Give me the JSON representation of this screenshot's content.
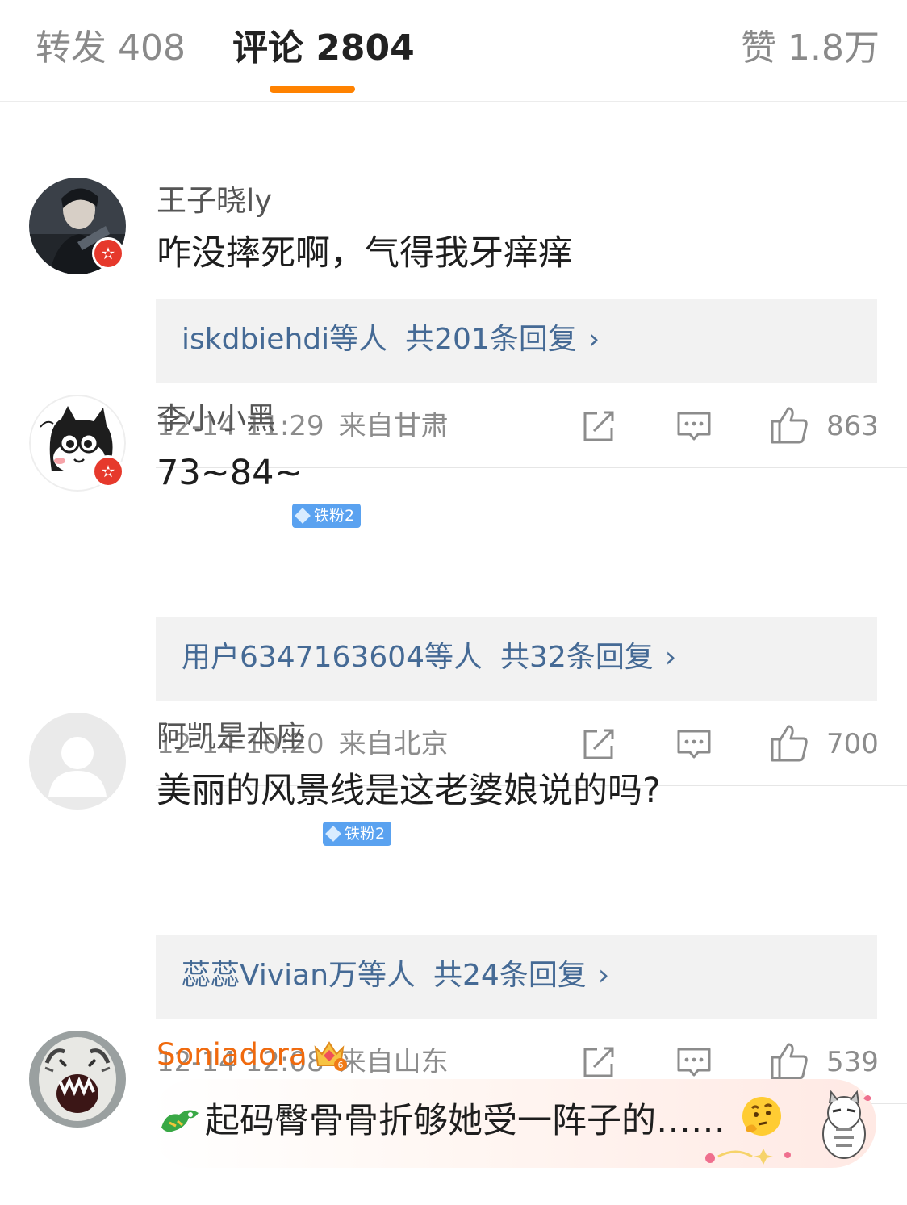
{
  "tabs": {
    "repost_label": "转发 408",
    "comments_label": "评论 2804",
    "likes_label": "赞 1.8万",
    "accent_color": "#ff8200"
  },
  "comments": [
    {
      "username": "王子晓ly",
      "text": "咋没摔死啊，气得我牙痒痒",
      "replies_users": "iskdbiehdi等人",
      "replies_count": "共201条回复",
      "time": "12-14 11:29",
      "location": "来自甘肃",
      "likes": "863",
      "verified": true
    },
    {
      "username": "李小小黑",
      "fan_badge": "铁粉2",
      "text": "73~84~",
      "replies_users": "用户6347163604等人",
      "replies_count": "共32条回复",
      "time": "12-14 10:20",
      "location": "来自北京",
      "likes": "700",
      "verified": true
    },
    {
      "username": "阿凯是本座",
      "fan_badge": "铁粉2",
      "text": "美丽的风景线是这老婆娘说的吗?",
      "replies_users": "蕊蕊Vivian万等人",
      "replies_count": "共24条回复",
      "time": "12-14 12:08",
      "location": "来自山东",
      "likes": "539",
      "verified": false
    },
    {
      "username": "Soniadora",
      "vip_level": "6",
      "text": "起码臀骨骨折够她受一阵子的……",
      "name_color": "#f06a0e"
    }
  ],
  "icons": {
    "chevron": "›",
    "share": "share-icon",
    "reply": "comment-icon",
    "like": "thumbs-up-icon"
  },
  "colors": {
    "reply_link": "#456a95",
    "reply_bg": "#f2f2f2",
    "verified_badge": "#e6392c",
    "fan_badge": "#5aa2f0"
  }
}
